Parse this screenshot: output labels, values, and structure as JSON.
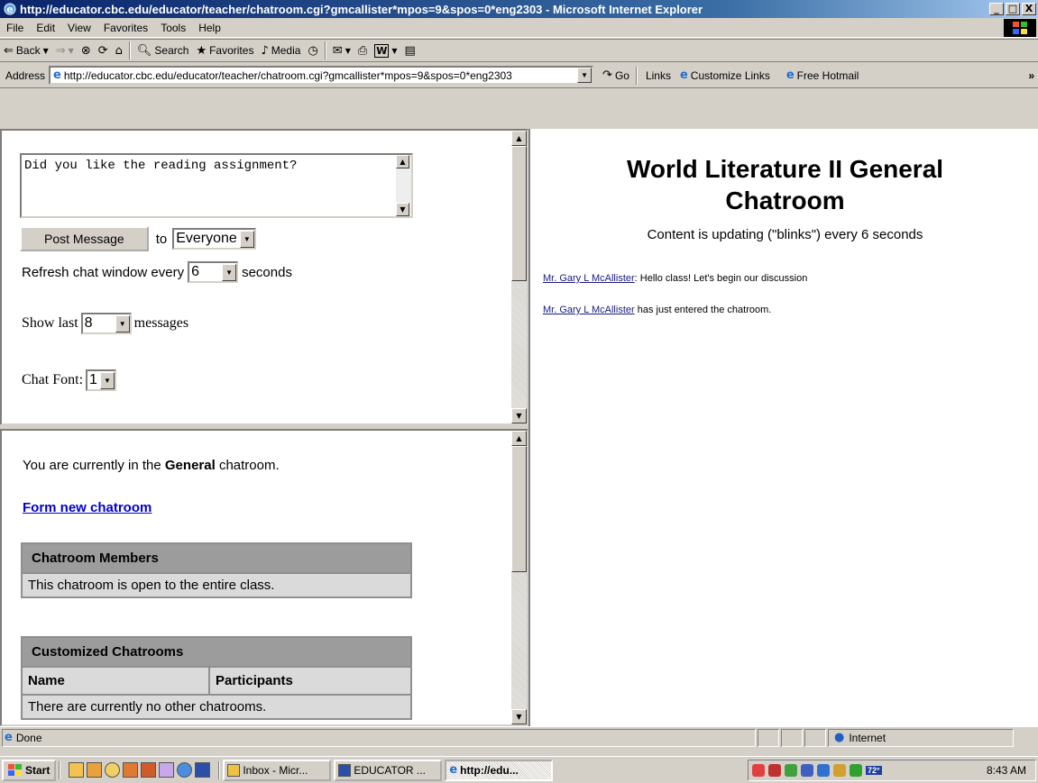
{
  "window": {
    "title": "http://educator.cbc.edu/educator/teacher/chatroom.cgi?gmcallister*mpos=9&spos=0*eng2303 - Microsoft Internet Explorer",
    "min": "_",
    "max": "□",
    "close": "X"
  },
  "menu": [
    "File",
    "Edit",
    "View",
    "Favorites",
    "Tools",
    "Help"
  ],
  "toolbar": {
    "back": "Back",
    "search": "Search",
    "favorites": "Favorites",
    "media": "Media"
  },
  "address": {
    "label": "Address",
    "url": "http://educator.cbc.edu/educator/teacher/chatroom.cgi?gmcallister*mpos=9&spos=0*eng2303",
    "go": "Go",
    "links": "Links",
    "link1": "Customize Links",
    "link2": "Free Hotmail"
  },
  "compose": {
    "message": "Did you like the reading assignment?",
    "post_label": "Post Message",
    "to_label": "to",
    "recipient": "Everyone",
    "refresh_pre": "Refresh chat window every",
    "refresh_value": "6",
    "refresh_post": "seconds",
    "show_pre": "Show last",
    "show_value": "8",
    "show_post": "messages",
    "font_label": "Chat Font:",
    "font_value": "1"
  },
  "room_info": {
    "current_pre": "You are currently in the",
    "current_room": "General",
    "current_post": "chatroom.",
    "form_new": "Form new chatroom",
    "members_header": "Chatroom Members",
    "members_text": "This chatroom is open to the entire class.",
    "custom_header": "Customized Chatrooms",
    "col_name": "Name",
    "col_participants": "Participants",
    "no_rooms": "There are currently no other chatrooms."
  },
  "chat": {
    "title": "World Literature II General Chatroom",
    "status": "Content is updating (\"blinks\") every 6 seconds",
    "messages": [
      {
        "author": "Mr. Gary L McAllister",
        "text": ": Hello class! Let's begin our discussion"
      },
      {
        "author": "Mr. Gary L McAllister",
        "text": " has just entered the chatroom."
      }
    ]
  },
  "statusbar": {
    "text": "Done",
    "zone": "Internet"
  },
  "taskbar": {
    "start": "Start",
    "tasks": [
      "Inbox - Micr...",
      "EDUCATOR ...",
      "http://edu..."
    ],
    "clock": "8:43 AM",
    "temp": "72°"
  }
}
